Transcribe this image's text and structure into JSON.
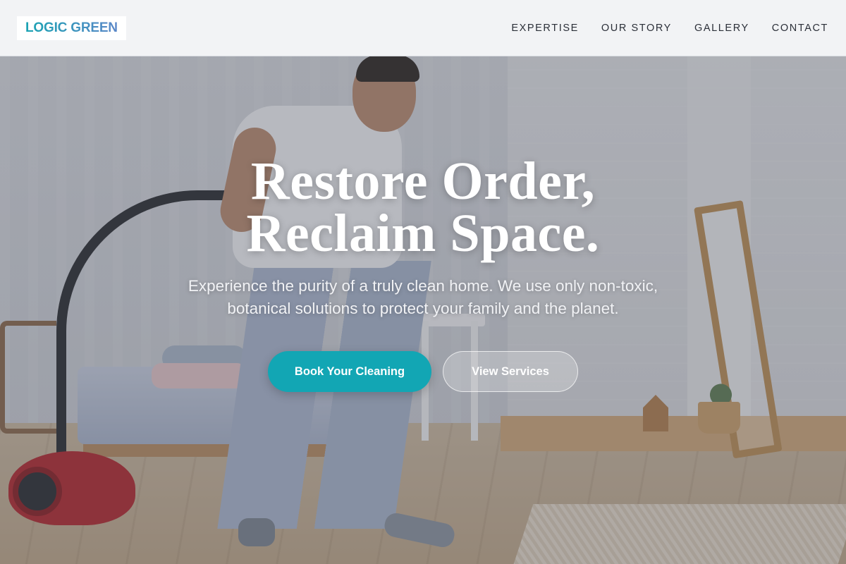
{
  "brand": {
    "logo_text": "LOGIC GREEN"
  },
  "nav": {
    "items": [
      {
        "label": "EXPERTISE"
      },
      {
        "label": "OUR STORY"
      },
      {
        "label": "GALLERY"
      },
      {
        "label": "CONTACT"
      }
    ]
  },
  "hero": {
    "title_line1": "Restore Order,",
    "title_line2": "Reclaim Space.",
    "subtitle": "Experience the purity of a truly clean home. We use only non-toxic, botanical solutions to protect your family and the planet.",
    "primary_cta": "Book Your Cleaning",
    "secondary_cta": "View Services"
  },
  "colors": {
    "accent": "#12a6b4",
    "logo_gradient_start": "#1aa3b3",
    "logo_gradient_end": "#5b87c8",
    "nav_text": "#2b2f38"
  }
}
